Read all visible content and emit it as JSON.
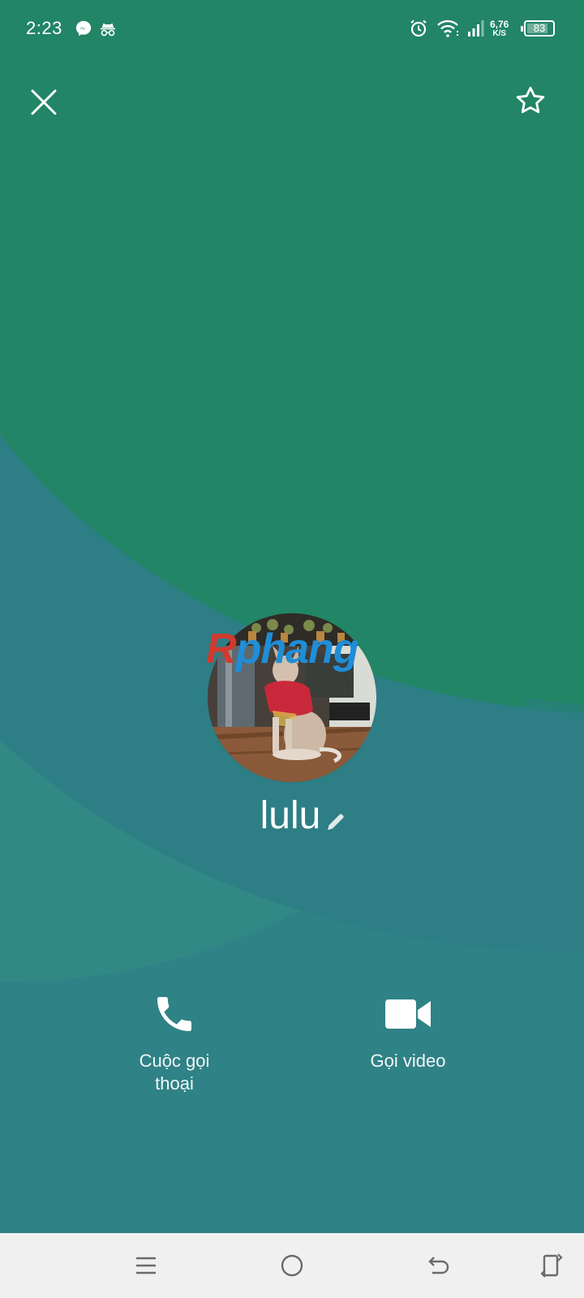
{
  "status_bar": {
    "time": "2:23",
    "net_speed_value": "6,76",
    "net_speed_unit": "K/S",
    "battery_level": "83",
    "battery_fraction": 0.83,
    "icons": [
      "messenger-icon",
      "incognito-icon",
      "alarm-icon",
      "wifi-icon",
      "signal-icon",
      "battery-icon"
    ]
  },
  "header": {
    "close_icon": "close-icon",
    "favorite_icon": "star-outline-icon"
  },
  "contact": {
    "name": "lulu",
    "edit_icon": "pencil-icon",
    "watermark_first": "R",
    "watermark_rest": "phang"
  },
  "actions": {
    "voice_call_label": "Cuộc gọi thoại",
    "video_call_label": "Gọi video"
  },
  "nav_bar": {
    "icons": [
      "menu-icon",
      "home-icon",
      "back-icon",
      "rotate-icon"
    ]
  },
  "colors": {
    "top_background": "#218566",
    "bottom_background": "#2d7e85",
    "accent_band": "#348a87",
    "nav_background": "#f0f0f0"
  }
}
